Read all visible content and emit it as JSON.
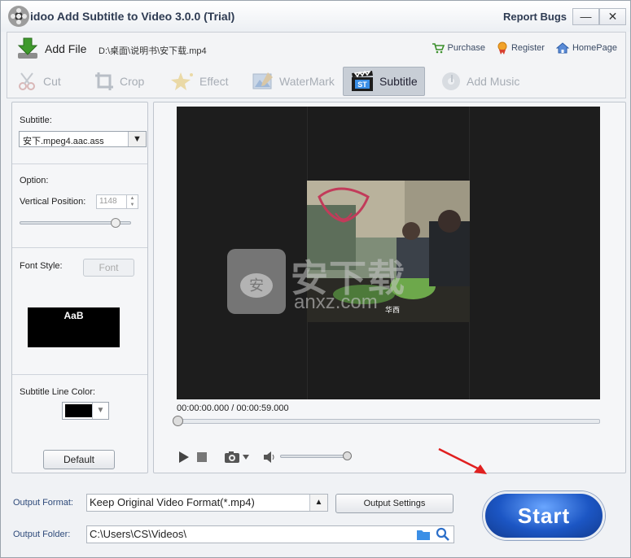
{
  "window": {
    "title": "idoo Add Subtitle to Video 3.0.0 (Trial)",
    "report_bugs": "Report Bugs",
    "minimize": "—",
    "close": "✕"
  },
  "toolbar": {
    "add_file": "Add File",
    "file_path": "D:\\桌面\\说明书\\安下载.mp4",
    "links": {
      "purchase": "Purchase",
      "register": "Register",
      "homepage": "HomePage"
    }
  },
  "tabs": [
    {
      "label": "Cut",
      "icon": "scissors-icon",
      "active": false
    },
    {
      "label": "Crop",
      "icon": "crop-icon",
      "active": false
    },
    {
      "label": "Effect",
      "icon": "sparkle-icon",
      "active": false
    },
    {
      "label": "WaterMark",
      "icon": "watermark-icon",
      "active": false
    },
    {
      "label": "Subtitle",
      "icon": "clapper-st-icon",
      "active": true
    },
    {
      "label": "Add Music",
      "icon": "music-disc-icon",
      "active": false
    }
  ],
  "subtitle_panel": {
    "subtitle_label": "Subtitle:",
    "subtitle_file": "安下.mpeg4.aac.ass",
    "option_label": "Option:",
    "vertical_position_label": "Vertical Position:",
    "vertical_position_value": "1148",
    "vertical_position_fraction": 0.85,
    "font_style_label": "Font Style:",
    "font_button": "Font",
    "preview_text": "AaB",
    "line_color_label": "Subtitle Line Color:",
    "line_color": "#000000",
    "default_button": "Default"
  },
  "player": {
    "time": "00:00:00.000 / 00:00:59.000",
    "position_fraction": 0.0,
    "volume_fraction": 0.95,
    "watermark_text": "安下载",
    "watermark_sub": "anxz.com"
  },
  "output": {
    "format_label": "Output Format:",
    "format_value": "Keep Original Video Format(*.mp4)",
    "settings_button": "Output Settings",
    "folder_label": "Output Folder:",
    "folder_value": "C:\\Users\\CS\\Videos\\"
  },
  "start_button": "Start",
  "colors": {
    "start": "#1c56c4",
    "arrow": "#e02020",
    "title": "#2e3b52"
  }
}
